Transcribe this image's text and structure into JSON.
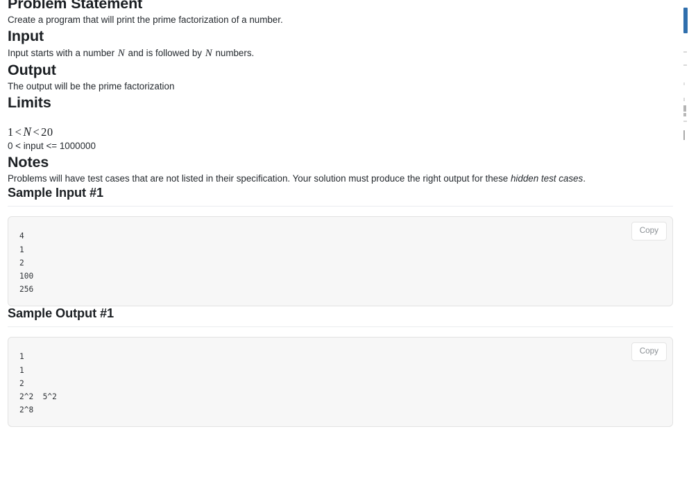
{
  "sections": {
    "problem_statement": {
      "heading": "Problem Statement",
      "body": "Create a program that will print the prime factorization of a number."
    },
    "input": {
      "heading": "Input",
      "body_before": "Input starts with a number ",
      "var1": "N",
      "body_middle": " and is followed by ",
      "var2": "N",
      "body_after": " numbers."
    },
    "output": {
      "heading": "Output",
      "body": "The output will be the prime factorization"
    },
    "limits": {
      "heading": "Limits",
      "math_lower": "1",
      "math_op1": "<",
      "math_var": "N",
      "math_op2": "<",
      "math_upper": "20",
      "plain": "0 < input <= 1000000"
    },
    "notes": {
      "heading": "Notes",
      "body_before": "Problems will have test cases that are not listed in their specification. Your solution must produce the right output for these ",
      "emphasis": "hidden test cases",
      "body_after": "."
    }
  },
  "sample_input": {
    "heading": "Sample Input #1",
    "copy_label": "Copy",
    "code": "4\n1\n2\n100\n256"
  },
  "sample_output": {
    "heading": "Sample Output #1",
    "copy_label": "Copy",
    "code": "1\n1\n2\n2^2  5^2\n2^8"
  },
  "colors": {
    "text": "#24292e",
    "heading": "#1b1f23",
    "code_bg": "#f7f7f7",
    "code_border": "#e2e2e2",
    "rule": "#eaecef",
    "copy_text": "#8a8f94",
    "scrollbar_thumb": "#2f6fad"
  }
}
